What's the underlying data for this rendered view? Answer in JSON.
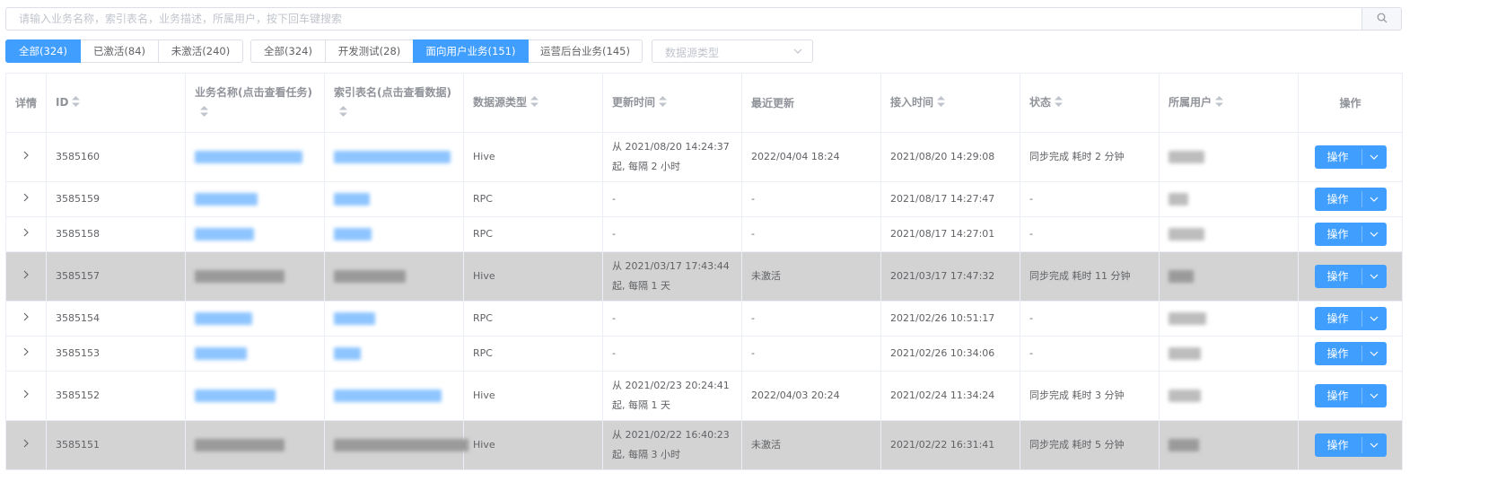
{
  "search": {
    "placeholder": "请输入业务名称，索引表名，业务描述，所属用户，按下回车键搜索",
    "value": ""
  },
  "status_filter": [
    {
      "label": "全部(324)",
      "active": true
    },
    {
      "label": "已激活(84)",
      "active": false
    },
    {
      "label": "未激活(240)",
      "active": false
    }
  ],
  "category_filter": [
    {
      "label": "全部(324)",
      "active": false
    },
    {
      "label": "开发测试(28)",
      "active": false
    },
    {
      "label": "面向用户业务(151)",
      "active": true
    },
    {
      "label": "运营后台业务(145)",
      "active": false
    }
  ],
  "datasource_select": {
    "placeholder": "数据源类型"
  },
  "columns": {
    "detail": "详情",
    "id": "ID",
    "biz_name": "业务名称(点击查看任务)",
    "index_table": "索引表名(点击查看数据)",
    "ds_type": "数据源类型",
    "update_time": "更新时间",
    "last_update": "最近更新",
    "join_time": "接入时间",
    "status": "状态",
    "owner": "所属用户",
    "action": "操作"
  },
  "rows": [
    {
      "id": "3585160",
      "ds": "Hive",
      "upd1": "从 2021/08/20 14:24:37",
      "upd2": "起, 每隔 2 小时",
      "last": "2022/04/04 18:24",
      "join": "2021/08/20 14:29:08",
      "status": "同步完成 耗时 2 分钟",
      "gray": false
    },
    {
      "id": "3585159",
      "ds": "RPC",
      "upd1": "-",
      "upd2": "",
      "last": "-",
      "join": "2021/08/17 14:27:47",
      "status": "-",
      "gray": false
    },
    {
      "id": "3585158",
      "ds": "RPC",
      "upd1": "-",
      "upd2": "",
      "last": "-",
      "join": "2021/08/17 14:27:01",
      "status": "-",
      "gray": false
    },
    {
      "id": "3585157",
      "ds": "Hive",
      "upd1": "从 2021/03/17 17:43:44",
      "upd2": "起, 每隔 1 天",
      "last": "未激活",
      "join": "2021/03/17 17:47:32",
      "status": "同步完成 耗时 11 分钟",
      "gray": true
    },
    {
      "id": "3585154",
      "ds": "RPC",
      "upd1": "-",
      "upd2": "",
      "last": "-",
      "join": "2021/02/26 10:51:17",
      "status": "-",
      "gray": false
    },
    {
      "id": "3585153",
      "ds": "RPC",
      "upd1": "-",
      "upd2": "",
      "last": "-",
      "join": "2021/02/26 10:34:06",
      "status": "-",
      "gray": false
    },
    {
      "id": "3585152",
      "ds": "Hive",
      "upd1": "从 2021/02/23 20:24:41",
      "upd2": "起, 每隔 1 天",
      "last": "2022/04/03 20:24",
      "join": "2021/02/24 11:34:24",
      "status": "同步完成 耗时 3 分钟",
      "gray": false
    },
    {
      "id": "3585151",
      "ds": "Hive",
      "upd1": "从 2021/02/22 16:40:23",
      "upd2": "起, 每隔 3 小时",
      "last": "未激活",
      "join": "2021/02/22 16:31:41",
      "status": "同步完成 耗时 5 分钟",
      "gray": true
    }
  ],
  "action_label": "操作",
  "colors": {
    "primary": "#409eff",
    "border": "#dcdfe6",
    "row_highlight": "#d3d3d3"
  }
}
